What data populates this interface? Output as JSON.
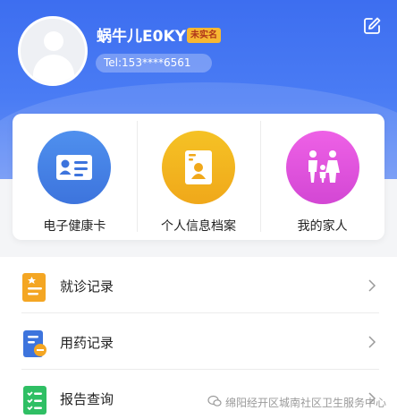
{
  "profile": {
    "username": "蜗牛儿E0KY",
    "badge": "未实名",
    "phone": "Tel:153****6561"
  },
  "cards": [
    {
      "label": "电子健康卡",
      "icon": "id-card-icon",
      "color": "#3d74dd"
    },
    {
      "label": "个人信息档案",
      "icon": "profile-file-icon",
      "color": "#f0a81a"
    },
    {
      "label": "我的家人",
      "icon": "family-icon",
      "color": "#d347d4"
    }
  ],
  "menu": [
    {
      "label": "就诊记录",
      "icon": "visit-record-icon"
    },
    {
      "label": "用药记录",
      "icon": "medication-record-icon"
    },
    {
      "label": "报告查询",
      "icon": "report-icon"
    }
  ],
  "watermark": "绵阳经开区城南社区卫生服务中心",
  "colors": {
    "header": "#3d6ef0",
    "accent": "#f7b733"
  }
}
